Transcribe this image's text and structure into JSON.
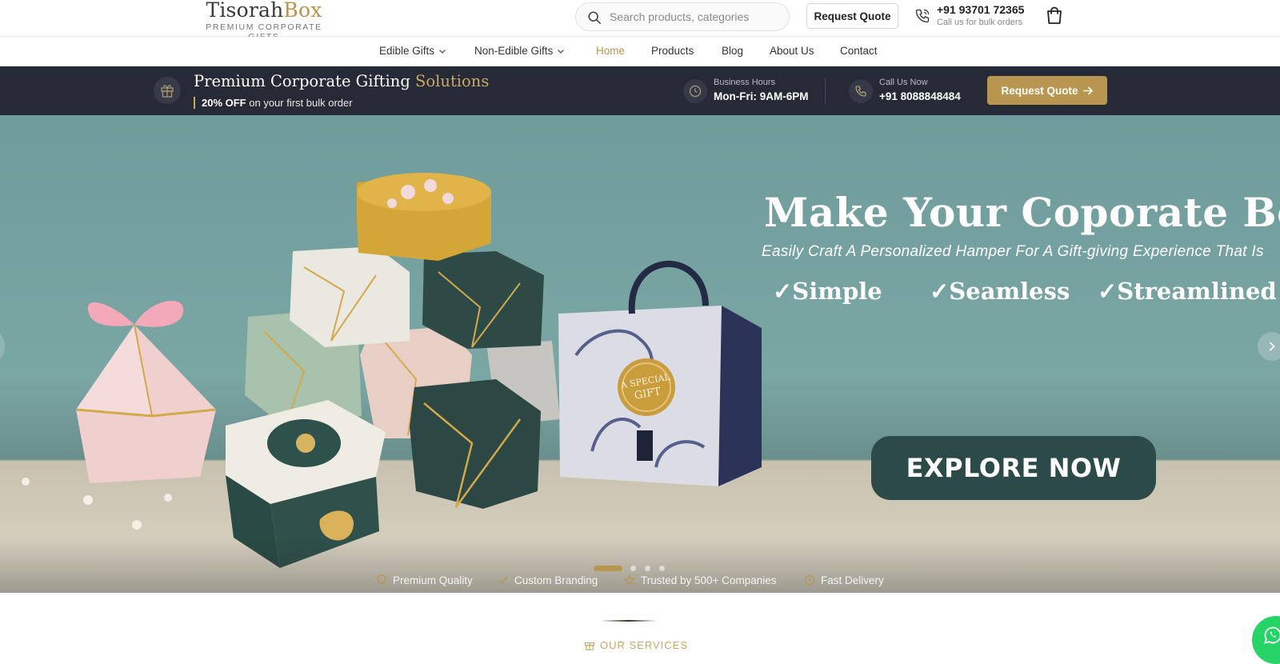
{
  "header": {
    "logo_main": "Tisorah",
    "logo_accent": "Box",
    "logo_tagline": "PREMIUM CORPORATE GIFTS",
    "search_placeholder": "Search products, categories",
    "request_quote_label": "Request Quote",
    "phone_number": "+91 93701 72365",
    "phone_caption": "Call us for bulk orders",
    "cart_icon": "shopping-bag-icon"
  },
  "nav": {
    "items": [
      {
        "label": "Edible Gifts",
        "dropdown": true
      },
      {
        "label": "Non-Edible Gifts",
        "dropdown": true
      },
      {
        "label": "Home",
        "active": true
      },
      {
        "label": "Products"
      },
      {
        "label": "Blog"
      },
      {
        "label": "About Us"
      },
      {
        "label": "Contact"
      }
    ]
  },
  "promo_bar": {
    "title_main": "Premium Corporate Gifting",
    "title_accent": "Solutions",
    "offer_bold": "20% OFF",
    "offer_rest": "on your first bulk order",
    "hours_label": "Business Hours",
    "hours_value": "Mon-Fri: 9AM-6PM",
    "call_label": "Call Us Now",
    "call_value": "+91 8088848484",
    "button_label": "Request Quote",
    "colors": {
      "background": "#262a36",
      "accent": "#b8964f"
    }
  },
  "hero": {
    "title": "Make Your Coporate Box",
    "subtitle": "Easily Craft A Personalized Hamper For A Gift-giving Experience That Is",
    "features": [
      "✓Simple",
      "✓Seamless",
      "✓Streamlined"
    ],
    "cta_label": "EXPLORE NOW",
    "slides_total": 4,
    "active_slide": 1,
    "image_description_icons": [
      "gift-boxes-image"
    ],
    "badges": [
      "Premium Quality",
      "Custom Branding",
      "Trusted by 500+ Companies",
      "Fast Delivery"
    ],
    "colors": {
      "cta_background": "#2c4a48",
      "backdrop": "#76a3a0"
    }
  },
  "services": {
    "label": "OUR SERVICES"
  }
}
